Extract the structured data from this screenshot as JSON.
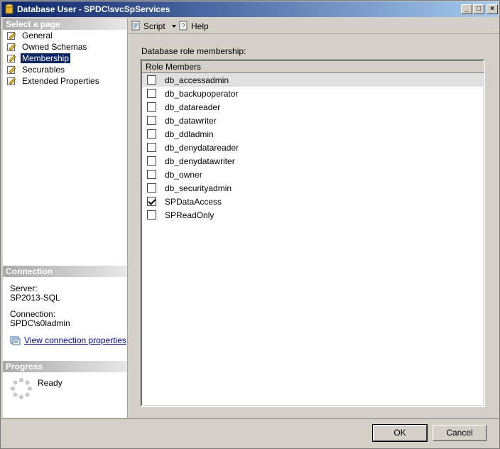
{
  "window": {
    "title": "Database User - SPDC\\svcSpServices",
    "controls": {
      "minimize": "_",
      "maximize": "□",
      "close": "×"
    }
  },
  "left": {
    "select_page_header": "Select a page",
    "pages": [
      {
        "label": "General",
        "icon": "page-icon"
      },
      {
        "label": "Owned Schemas",
        "icon": "page-icon"
      },
      {
        "label": "Membership",
        "icon": "page-icon",
        "selected": true
      },
      {
        "label": "Securables",
        "icon": "page-icon"
      },
      {
        "label": "Extended Properties",
        "icon": "page-icon"
      }
    ],
    "connection_header": "Connection",
    "server_label": "Server:",
    "server_value": "SP2013-SQL",
    "connection_label": "Connection:",
    "connection_value": "SPDC\\s0ladmin",
    "view_properties_link": "View connection properties",
    "progress_header": "Progress",
    "progress_status": "Ready"
  },
  "toolbar": {
    "script_label": "Script",
    "help_label": "Help"
  },
  "main": {
    "role_membership_label": "Database role membership:",
    "column_header": "Role Members",
    "roles": [
      {
        "name": "db_accessadmin",
        "checked": false
      },
      {
        "name": "db_backupoperator",
        "checked": false
      },
      {
        "name": "db_datareader",
        "checked": false
      },
      {
        "name": "db_datawriter",
        "checked": false
      },
      {
        "name": "db_ddladmin",
        "checked": false
      },
      {
        "name": "db_denydatareader",
        "checked": false
      },
      {
        "name": "db_denydatawriter",
        "checked": false
      },
      {
        "name": "db_owner",
        "checked": false
      },
      {
        "name": "db_securityadmin",
        "checked": false
      },
      {
        "name": "SPDataAccess",
        "checked": true
      },
      {
        "name": "SPReadOnly",
        "checked": false
      }
    ]
  },
  "buttons": {
    "ok": "OK",
    "cancel": "Cancel"
  },
  "colors": {
    "title_start": "#0a246a",
    "title_end": "#a6caf0",
    "selection": "#0a246a",
    "link": "#0000cc"
  }
}
